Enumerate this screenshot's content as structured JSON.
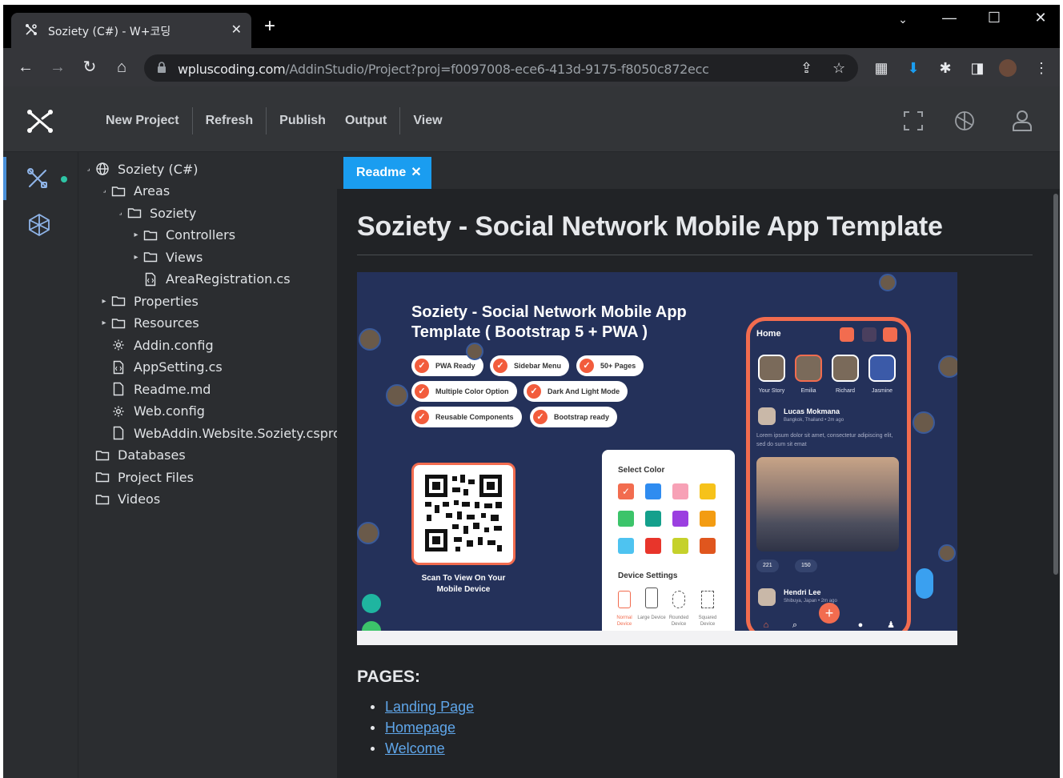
{
  "browser": {
    "tab_title": "Soziety (C#) - W+코딩",
    "url_host": "wpluscoding.com",
    "url_path": "/AddinStudio/Project?proj=f0097008-ece6-413d-9175-f8050c872ecc"
  },
  "app": {
    "menu": [
      "New Project",
      "Refresh",
      "Publish",
      "Output",
      "View"
    ]
  },
  "explorer": {
    "items": [
      {
        "label": "Soziety (C#)",
        "icon": "globe-icon",
        "twisty": "open"
      },
      {
        "label": "Areas",
        "icon": "folder-icon",
        "twisty": "open"
      },
      {
        "label": "Soziety",
        "icon": "folder-icon",
        "twisty": "open"
      },
      {
        "label": "Controllers",
        "icon": "folder-icon",
        "twisty": "closed"
      },
      {
        "label": "Views",
        "icon": "folder-icon",
        "twisty": "closed"
      },
      {
        "label": "AreaRegistration.cs",
        "icon": "code-file-icon",
        "twisty": "none"
      },
      {
        "label": "Properties",
        "icon": "folder-icon",
        "twisty": "closed"
      },
      {
        "label": "Resources",
        "icon": "folder-icon",
        "twisty": "closed"
      },
      {
        "label": "Addin.config",
        "icon": "gear-file-icon",
        "twisty": "none"
      },
      {
        "label": "AppSetting.cs",
        "icon": "code-file-icon",
        "twisty": "none"
      },
      {
        "label": "Readme.md",
        "icon": "file-icon",
        "twisty": "none"
      },
      {
        "label": "Web.config",
        "icon": "gear-file-icon",
        "twisty": "none"
      },
      {
        "label": "WebAddin.Website.Soziety.csproj",
        "icon": "file-icon",
        "twisty": "none"
      },
      {
        "label": "Databases",
        "icon": "folder-icon",
        "twisty": "none"
      },
      {
        "label": "Project Files",
        "icon": "folder-icon",
        "twisty": "none"
      },
      {
        "label": "Videos",
        "icon": "folder-icon",
        "twisty": "none"
      }
    ]
  },
  "editor": {
    "tab_label": "Readme",
    "doc_title": "Soziety - Social Network Mobile App Template",
    "pages_heading": "PAGES:",
    "pages": [
      "Landing Page",
      "Homepage",
      "Welcome"
    ]
  },
  "hero": {
    "title": "Soziety - Social Network Mobile App Template ( Bootstrap 5 + PWA )",
    "pills": [
      "PWA Ready",
      "Sidebar Menu",
      "50+ Pages",
      "Multiple Color Option",
      "Dark And Light Mode",
      "Reusable Components",
      "Bootstrap ready"
    ],
    "qr_caption": "Scan To View On Your Mobile Device",
    "select_color": "Select Color",
    "device_settings": "Device Settings",
    "devices": [
      "Normal Device",
      "Large Device",
      "Rounded Device",
      "Squared Device"
    ],
    "swatches": [
      "#f26c4f",
      "#2f8cf0",
      "#f7a1b6",
      "#f6c21a",
      "#3cc46a",
      "#14a08c",
      "#9b3fe0",
      "#f39c12",
      "#4ec3f0",
      "#e8352b",
      "#c5d12b",
      "#e0561e"
    ],
    "phone": {
      "title": "Home",
      "stories": [
        "Your Story",
        "Emilia",
        "Richard",
        "Jasmine"
      ],
      "post_name": "Lucas Mokmana",
      "post_location": "Bangkok, Thailand • 2m ago",
      "post_text": "Lorem ipsum dolor sit amet, consectetur adipiscing elit, sed do sum sit emat",
      "likes": "221",
      "comments": "150",
      "post2_name": "Hendri Lee",
      "post2_location": "Shibuya, Japan • 2m ago"
    }
  }
}
